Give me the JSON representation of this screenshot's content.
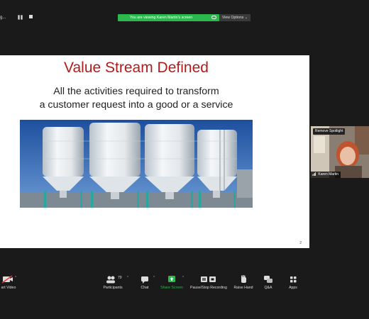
{
  "top_bar": {
    "left_text": "g...",
    "sharing_banner": "You are viewing Karen Martin's screen",
    "view_options": "View Options ⌄"
  },
  "slide": {
    "title": "Value Stream Defined",
    "subtitle_line1": "All the activities required to transform",
    "subtitle_line2": "a customer request into a good or a service",
    "page_number": "2"
  },
  "participant": {
    "remove_spotlight": "Remove Spotlight",
    "name": "Karen Martin"
  },
  "toolbar": {
    "video_label": "art Video",
    "participants_label": "Participants",
    "participants_count": "79",
    "chat_label": "Chat",
    "share_screen_label": "Share Screen",
    "recording_label": "Pause/Stop Recording",
    "raise_hand_label": "Raise Hand",
    "qa_label": "Q&A",
    "apps_label": "Apps"
  },
  "colors": {
    "banner_green": "#2bb84d",
    "share_green": "#2bb84d",
    "title_red": "#b01c1c",
    "background": "#1a1a1a"
  },
  "icons": [
    "video-off-icon",
    "participants-icon",
    "chat-icon",
    "share-screen-icon",
    "recording-icon",
    "raise-hand-icon",
    "qa-icon",
    "apps-icon",
    "mic-icon",
    "cloud-icon"
  ]
}
